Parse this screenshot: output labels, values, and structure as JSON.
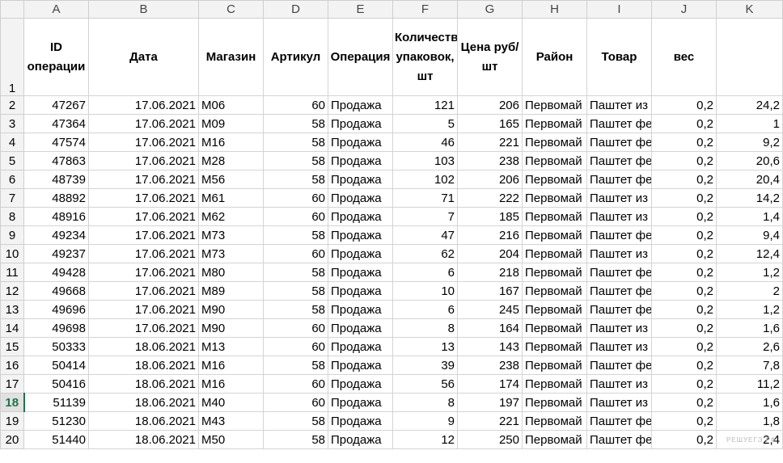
{
  "columns": [
    "A",
    "B",
    "C",
    "D",
    "E",
    "F",
    "G",
    "H",
    "I",
    "J",
    "K"
  ],
  "active_row": "18",
  "headers": [
    "ID операции",
    "Дата",
    "Магазин",
    "Артикул",
    "Операция",
    "Количество упаковок, шт",
    "Цена руб/шт",
    "Район",
    "Товар",
    "вес",
    ""
  ],
  "rows": [
    {
      "n": "2",
      "id": "47267",
      "date": "17.06.2021",
      "shop": "M06",
      "art": "60",
      "op": "Продажа",
      "qty": "121",
      "price": "206",
      "area": "Первомай",
      "item": "Паштет из",
      "w": "0,2",
      "k": "24,2"
    },
    {
      "n": "3",
      "id": "47364",
      "date": "17.06.2021",
      "shop": "M09",
      "art": "58",
      "op": "Продажа",
      "qty": "5",
      "price": "165",
      "area": "Первомай",
      "item": "Паштет фе",
      "w": "0,2",
      "k": "1"
    },
    {
      "n": "4",
      "id": "47574",
      "date": "17.06.2021",
      "shop": "M16",
      "art": "58",
      "op": "Продажа",
      "qty": "46",
      "price": "221",
      "area": "Первомай",
      "item": "Паштет фе",
      "w": "0,2",
      "k": "9,2"
    },
    {
      "n": "5",
      "id": "47863",
      "date": "17.06.2021",
      "shop": "M28",
      "art": "58",
      "op": "Продажа",
      "qty": "103",
      "price": "238",
      "area": "Первомай",
      "item": "Паштет фе",
      "w": "0,2",
      "k": "20,6"
    },
    {
      "n": "6",
      "id": "48739",
      "date": "17.06.2021",
      "shop": "M56",
      "art": "58",
      "op": "Продажа",
      "qty": "102",
      "price": "206",
      "area": "Первомай",
      "item": "Паштет фе",
      "w": "0,2",
      "k": "20,4"
    },
    {
      "n": "7",
      "id": "48892",
      "date": "17.06.2021",
      "shop": "M61",
      "art": "60",
      "op": "Продажа",
      "qty": "71",
      "price": "222",
      "area": "Первомай",
      "item": "Паштет из",
      "w": "0,2",
      "k": "14,2"
    },
    {
      "n": "8",
      "id": "48916",
      "date": "17.06.2021",
      "shop": "M62",
      "art": "60",
      "op": "Продажа",
      "qty": "7",
      "price": "185",
      "area": "Первомай",
      "item": "Паштет из",
      "w": "0,2",
      "k": "1,4"
    },
    {
      "n": "9",
      "id": "49234",
      "date": "17.06.2021",
      "shop": "M73",
      "art": "58",
      "op": "Продажа",
      "qty": "47",
      "price": "216",
      "area": "Первомай",
      "item": "Паштет фе",
      "w": "0,2",
      "k": "9,4"
    },
    {
      "n": "10",
      "id": "49237",
      "date": "17.06.2021",
      "shop": "M73",
      "art": "60",
      "op": "Продажа",
      "qty": "62",
      "price": "204",
      "area": "Первомай",
      "item": "Паштет из",
      "w": "0,2",
      "k": "12,4"
    },
    {
      "n": "11",
      "id": "49428",
      "date": "17.06.2021",
      "shop": "M80",
      "art": "58",
      "op": "Продажа",
      "qty": "6",
      "price": "218",
      "area": "Первомай",
      "item": "Паштет фе",
      "w": "0,2",
      "k": "1,2"
    },
    {
      "n": "12",
      "id": "49668",
      "date": "17.06.2021",
      "shop": "M89",
      "art": "58",
      "op": "Продажа",
      "qty": "10",
      "price": "167",
      "area": "Первомай",
      "item": "Паштет фе",
      "w": "0,2",
      "k": "2"
    },
    {
      "n": "13",
      "id": "49696",
      "date": "17.06.2021",
      "shop": "M90",
      "art": "58",
      "op": "Продажа",
      "qty": "6",
      "price": "245",
      "area": "Первомай",
      "item": "Паштет фе",
      "w": "0,2",
      "k": "1,2"
    },
    {
      "n": "14",
      "id": "49698",
      "date": "17.06.2021",
      "shop": "M90",
      "art": "60",
      "op": "Продажа",
      "qty": "8",
      "price": "164",
      "area": "Первомай",
      "item": "Паштет из",
      "w": "0,2",
      "k": "1,6"
    },
    {
      "n": "15",
      "id": "50333",
      "date": "18.06.2021",
      "shop": "M13",
      "art": "60",
      "op": "Продажа",
      "qty": "13",
      "price": "143",
      "area": "Первомай",
      "item": "Паштет из",
      "w": "0,2",
      "k": "2,6"
    },
    {
      "n": "16",
      "id": "50414",
      "date": "18.06.2021",
      "shop": "M16",
      "art": "58",
      "op": "Продажа",
      "qty": "39",
      "price": "238",
      "area": "Первомай",
      "item": "Паштет фе",
      "w": "0,2",
      "k": "7,8"
    },
    {
      "n": "17",
      "id": "50416",
      "date": "18.06.2021",
      "shop": "M16",
      "art": "60",
      "op": "Продажа",
      "qty": "56",
      "price": "174",
      "area": "Первомай",
      "item": "Паштет из",
      "w": "0,2",
      "k": "11,2"
    },
    {
      "n": "18",
      "id": "51139",
      "date": "18.06.2021",
      "shop": "M40",
      "art": "60",
      "op": "Продажа",
      "qty": "8",
      "price": "197",
      "area": "Первомай",
      "item": "Паштет из",
      "w": "0,2",
      "k": "1,6"
    },
    {
      "n": "19",
      "id": "51230",
      "date": "18.06.2021",
      "shop": "M43",
      "art": "58",
      "op": "Продажа",
      "qty": "9",
      "price": "221",
      "area": "Первомай",
      "item": "Паштет фе",
      "w": "0,2",
      "k": "1,8"
    },
    {
      "n": "20",
      "id": "51440",
      "date": "18.06.2021",
      "shop": "M50",
      "art": "58",
      "op": "Продажа",
      "qty": "12",
      "price": "250",
      "area": "Первомай",
      "item": "Паштет фе",
      "w": "0,2",
      "k": "2,4"
    }
  ],
  "watermark": "РЕШУЕГЭ.РФ"
}
